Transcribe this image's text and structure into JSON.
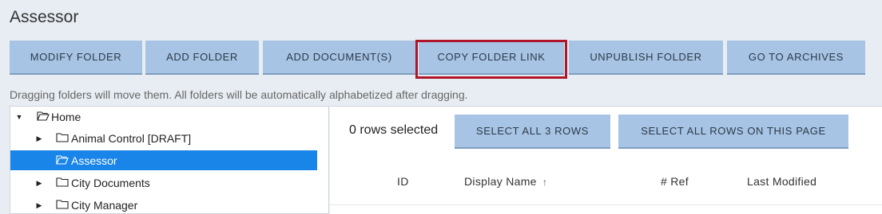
{
  "page": {
    "title": "Assessor"
  },
  "toolbar": {
    "modify_folder": "MODIFY FOLDER",
    "add_folder": "ADD FOLDER",
    "add_documents": "ADD DOCUMENT(S)",
    "copy_folder_link": "COPY FOLDER LINK",
    "unpublish_folder": "UNPUBLISH FOLDER",
    "go_to_archives": "GO TO ARCHIVES"
  },
  "hint": "Dragging folders will move them. All folders will be automatically alphabetized after dragging.",
  "tree": {
    "items": [
      {
        "label": "Home",
        "expanded": true,
        "selected": false
      },
      {
        "label": "Animal Control [DRAFT]",
        "expanded": false,
        "selected": false
      },
      {
        "label": "Assessor",
        "expanded": false,
        "selected": true
      },
      {
        "label": "City Documents",
        "expanded": false,
        "selected": false
      },
      {
        "label": "City Manager",
        "expanded": false,
        "selected": false
      }
    ]
  },
  "grid": {
    "rows_selected": "0 rows selected",
    "select_all_rows": "SELECT ALL 3 ROWS",
    "select_all_page": "SELECT ALL ROWS ON THIS PAGE",
    "columns": {
      "id": "ID",
      "display_name": "Display Name",
      "sort_indicator": "↑",
      "ref": "# Ref",
      "last_modified": "Last Modified"
    }
  },
  "colors": {
    "button_bg": "#a7c4e4",
    "selected_row": "#1a85e8",
    "highlight_border": "#b0152a"
  }
}
